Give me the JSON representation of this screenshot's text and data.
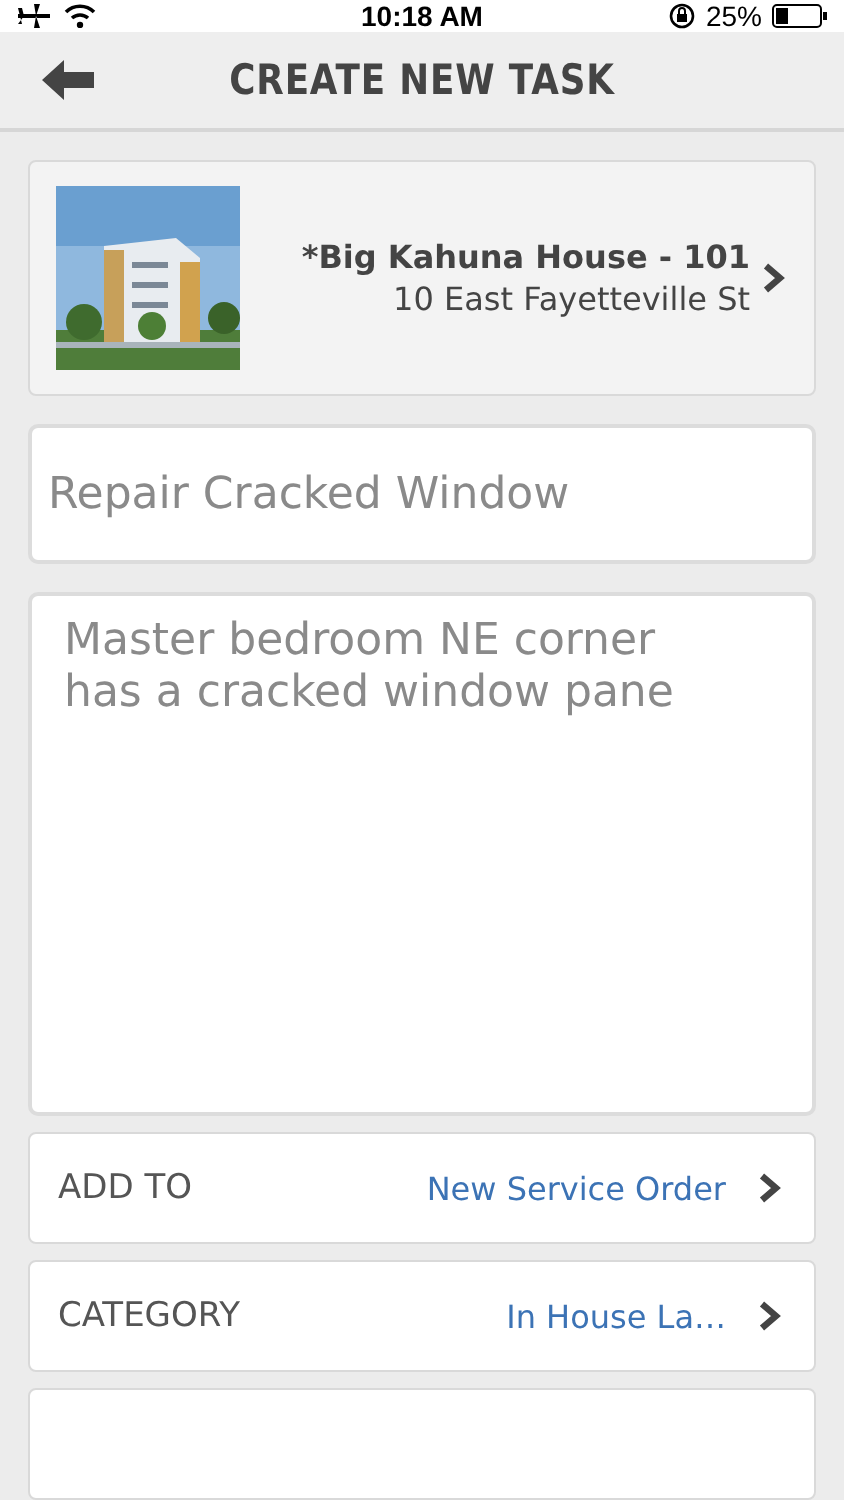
{
  "status_bar": {
    "time": "10:18 AM",
    "battery": "25%"
  },
  "header": {
    "title": "CREATE NEW TASK"
  },
  "property": {
    "name": "*Big Kahuna House - 101",
    "address": "10 East Fayetteville St"
  },
  "task_title": {
    "value": "Repair Cracked Window"
  },
  "description": {
    "value": "Master bedroom NE corner has a cracked window pane"
  },
  "rows": [
    {
      "label": "ADD TO",
      "value": "New Service Order"
    },
    {
      "label": "CATEGORY",
      "value": "In House La…"
    }
  ]
}
